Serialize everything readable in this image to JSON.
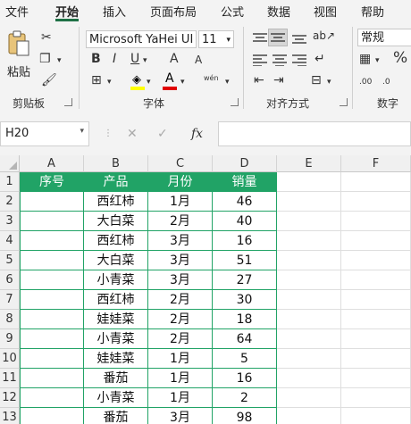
{
  "tabs": [
    "文件",
    "开始",
    "插入",
    "页面布局",
    "公式",
    "数据",
    "视图",
    "帮助"
  ],
  "ribbon": {
    "clipboard": {
      "paste_label": "粘贴",
      "group_label": "剪贴板"
    },
    "font": {
      "font_name": "Microsoft YaHei UI",
      "font_size": "11",
      "group_label": "字体",
      "bold": "B",
      "italic": "I",
      "underline": "U",
      "grow": "A",
      "shrink": "A",
      "phonetic": "wén"
    },
    "alignment": {
      "group_label": "对齐方式"
    },
    "number": {
      "format": "常规",
      "percent": "%",
      "group_label": "数字"
    }
  },
  "formula_bar": {
    "name_box": "H20",
    "cancel": "✕",
    "enter": "✓",
    "fx": "fx",
    "formula": ""
  },
  "columns": [
    "A",
    "B",
    "C",
    "D",
    "E",
    "F"
  ],
  "rows": [
    "1",
    "2",
    "3",
    "4",
    "5",
    "6",
    "7",
    "8",
    "9",
    "10",
    "11",
    "12",
    "13"
  ],
  "table": {
    "headers": [
      "序号",
      "产品",
      "月份",
      "销量"
    ],
    "data": [
      [
        "",
        "西红柿",
        "1月",
        "46"
      ],
      [
        "",
        "大白菜",
        "2月",
        "40"
      ],
      [
        "",
        "西红柿",
        "3月",
        "16"
      ],
      [
        "",
        "大白菜",
        "3月",
        "51"
      ],
      [
        "",
        "小青菜",
        "3月",
        "27"
      ],
      [
        "",
        "西红柿",
        "2月",
        "30"
      ],
      [
        "",
        "娃娃菜",
        "2月",
        "18"
      ],
      [
        "",
        "小青菜",
        "2月",
        "64"
      ],
      [
        "",
        "娃娃菜",
        "1月",
        "5"
      ],
      [
        "",
        "番茄",
        "1月",
        "16"
      ],
      [
        "",
        "小青菜",
        "1月",
        "2"
      ],
      [
        "",
        "番茄",
        "3月",
        "98"
      ]
    ]
  },
  "colors": {
    "accent": "#1e7145",
    "table_header": "#21a366"
  }
}
